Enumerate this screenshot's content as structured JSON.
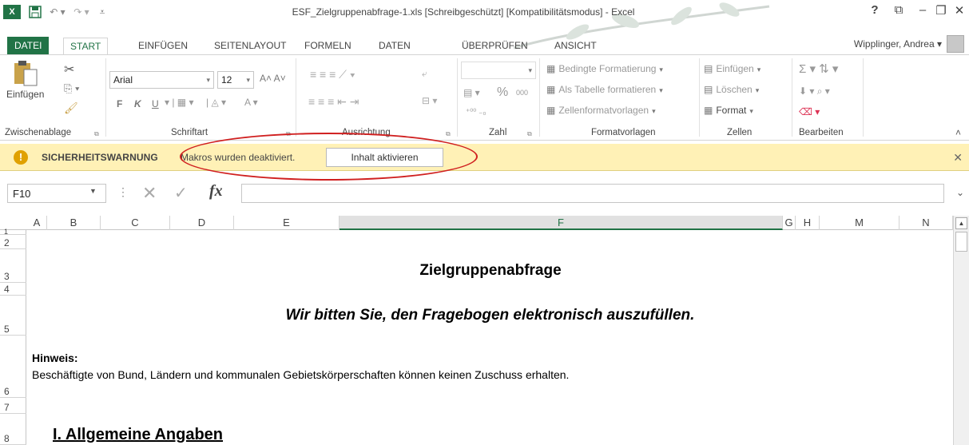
{
  "window": {
    "title": "ESF_Zielgruppenabfrage-1.xls  [Schreibgeschützt]  [Kompatibilitätsmodus] - Excel",
    "help": "?",
    "user": "Wipplinger, Andrea"
  },
  "tabs": [
    "DATEI",
    "START",
    "EINFÜGEN",
    "SEITENLAYOUT",
    "FORMELN",
    "DATEN",
    "ÜBERPRÜFEN",
    "ANSICHT"
  ],
  "ribbon": {
    "clipboard": {
      "paste": "Einfügen",
      "label": "Zwischenablage"
    },
    "font": {
      "name": "Arial",
      "size": "12",
      "bold": "F",
      "italic": "K",
      "underline": "U",
      "label": "Schriftart"
    },
    "alignment": {
      "label": "Ausrichtung"
    },
    "number": {
      "format": "",
      "percent": "%",
      "thousands": "000",
      "label": "Zahl"
    },
    "styles": {
      "conditional": "Bedingte Formatierung",
      "table": "Als Tabelle formatieren",
      "cell_styles": "Zellenformatvorlagen",
      "label": "Formatvorlagen"
    },
    "cells": {
      "insert": "Einfügen",
      "delete": "Löschen",
      "format": "Format",
      "label": "Zellen"
    },
    "editing": {
      "label": "Bearbeiten"
    }
  },
  "warning": {
    "icon": "!",
    "title": "SICHERHEITSWARNUNG",
    "message": "Makros wurden deaktiviert.",
    "button": "Inhalt aktivieren",
    "highlight_color": "#d02020"
  },
  "formula_bar": {
    "name_box": "F10",
    "fx": "fx",
    "value": ""
  },
  "columns": [
    "A",
    "B",
    "C",
    "D",
    "E",
    "F",
    "G",
    "H",
    "M",
    "N"
  ],
  "selected_column": "F",
  "rows": [
    "1",
    "2",
    "3",
    "4",
    "5",
    "6",
    "7",
    "8"
  ],
  "sheet": {
    "title": "Zielgruppenabfrage",
    "subtitle": "Wir bitten Sie, den Fragebogen elektronisch auszufüllen.",
    "hinweis_label": "Hinweis:",
    "hinweis_text": "Beschäftigte von Bund, Ländern und kommunalen Gebietskörperschaften können keinen Zuschuss erhalten.",
    "section": "I. Allgemeine Angaben"
  },
  "colors": {
    "excel_green": "#217346",
    "warning_bg": "#fff1b6"
  }
}
